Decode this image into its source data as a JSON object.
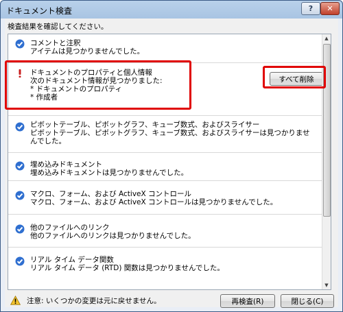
{
  "window": {
    "title": "ドキュメント検査",
    "help_label": "?",
    "close_label": "✕"
  },
  "instruction": "検査結果を確認してください。",
  "results": [
    {
      "title": "コメントと注釈",
      "detail_lines": [
        "アイテムは見つかりませんでした。"
      ],
      "status": "ok"
    },
    {
      "title": "ドキュメントのプロパティと個人情報",
      "detail_lines": [
        "次のドキュメント情報が見つかりました:",
        "* ドキュメントのプロパティ",
        "* 作成者"
      ],
      "status": "found",
      "action_label": "すべて削除"
    },
    {
      "title": "ピボットテーブル、ピボットグラフ、キューブ数式、およびスライサー",
      "detail_lines": [
        "ピボットテーブル、ピボットグラフ、キューブ数式、およびスライサーは見つかりませ",
        "んでした。"
      ],
      "status": "ok"
    },
    {
      "title": "埋め込みドキュメント",
      "detail_lines": [
        "埋め込みドキュメントは見つかりませんでした。"
      ],
      "status": "ok"
    },
    {
      "title": "マクロ、フォーム、および ActiveX コントロール",
      "detail_lines": [
        "マクロ、フォーム、および ActiveX コントロールは見つかりませんでした。"
      ],
      "status": "ok"
    },
    {
      "title": "他のファイルへのリンク",
      "detail_lines": [
        "他のファイルへのリンクは見つかりませんでした。"
      ],
      "status": "ok"
    },
    {
      "title": "リアル タイム データ関数",
      "detail_lines": [
        "リアル タイム データ (RTD) 関数は見つかりませんでした。"
      ],
      "status": "ok"
    }
  ],
  "footer": {
    "warning": "注意: いくつかの変更は元に戻せません。",
    "reinspect_label": "再検査(R)",
    "close_label": "閉じる(C)"
  },
  "colors": {
    "ok_icon": "#2f6fd0",
    "found_icon": "#c81e1e",
    "highlight": "#e00000"
  }
}
